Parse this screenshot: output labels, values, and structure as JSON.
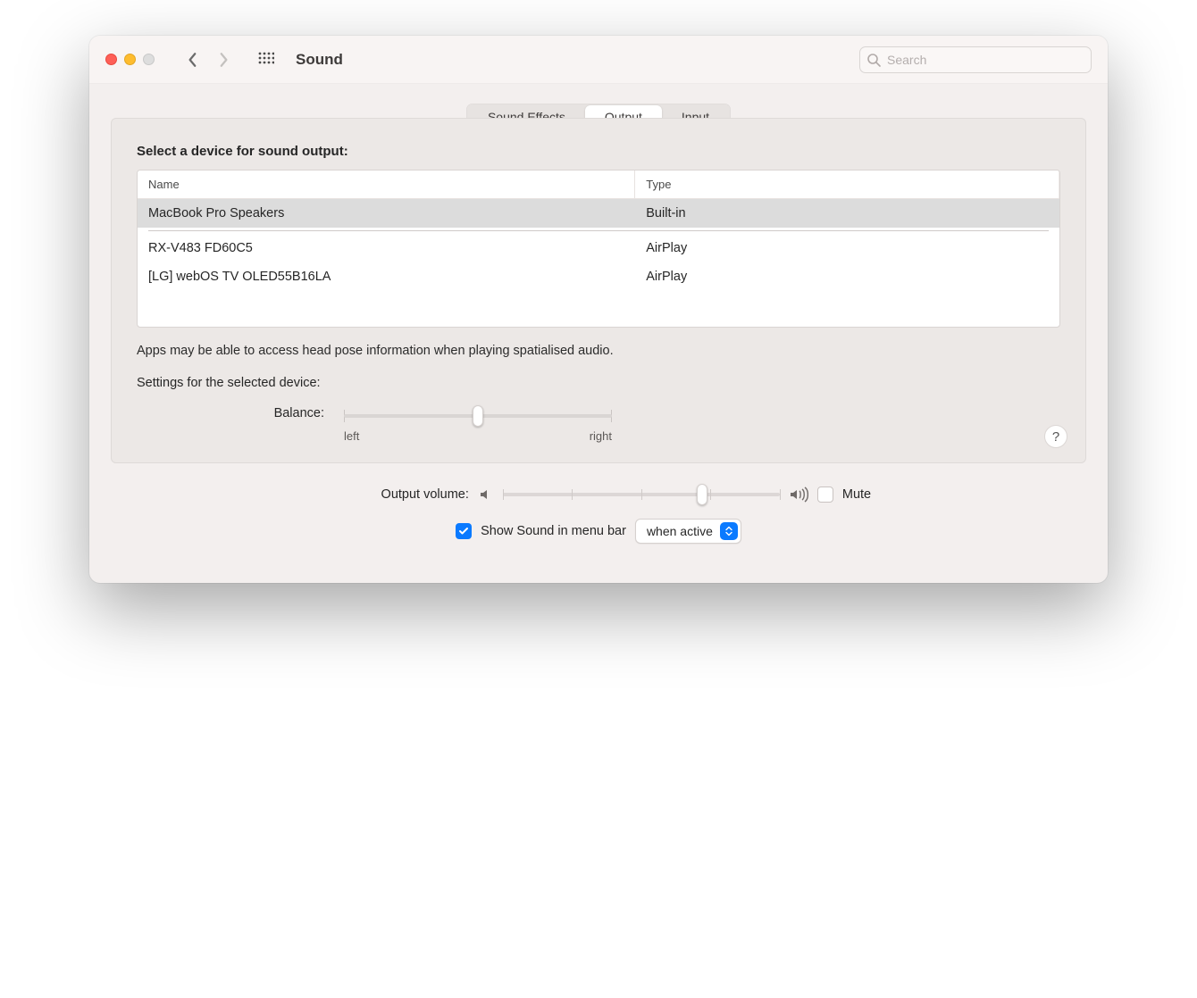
{
  "window": {
    "title": "Sound"
  },
  "search": {
    "placeholder": "Search"
  },
  "tabs": [
    {
      "label": "Sound Effects",
      "active": false
    },
    {
      "label": "Output",
      "active": true
    },
    {
      "label": "Input",
      "active": false
    }
  ],
  "output": {
    "heading": "Select a device for sound output:",
    "columns": {
      "name": "Name",
      "type": "Type"
    },
    "devices": [
      {
        "name": "MacBook Pro Speakers",
        "type": "Built-in",
        "selected": true
      },
      {
        "name": "RX-V483 FD60C5",
        "type": "AirPlay",
        "selected": false
      },
      {
        "name": "[LG] webOS TV OLED55B16LA",
        "type": "AirPlay",
        "selected": false
      }
    ],
    "note": "Apps may be able to access head pose information when playing spatialised audio.",
    "settings_label": "Settings for the selected device:",
    "balance": {
      "label": "Balance:",
      "left_label": "left",
      "right_label": "right",
      "value_percent": 50
    }
  },
  "footer": {
    "volume": {
      "label": "Output volume:",
      "value_percent": 72
    },
    "mute": {
      "label": "Mute",
      "checked": false
    },
    "show_in_menu": {
      "label": "Show Sound in menu bar",
      "checked": true
    },
    "menu_mode": {
      "selected": "when active"
    }
  },
  "help_label": "?"
}
